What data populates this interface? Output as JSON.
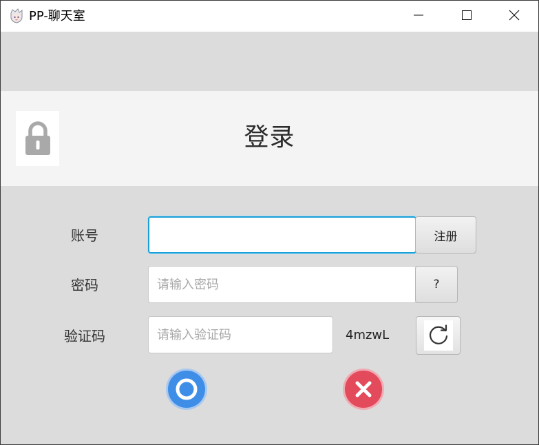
{
  "window": {
    "title": "PP-聊天室",
    "app_icon": "anime-avatar-icon",
    "controls": [
      "minimize-icon",
      "maximize-icon",
      "close-icon"
    ]
  },
  "header": {
    "title": "登录",
    "icon": "lock-icon"
  },
  "form": {
    "account": {
      "label": "账号",
      "value": "",
      "placeholder": "",
      "register_button": "注册"
    },
    "password": {
      "label": "密码",
      "value": "",
      "placeholder": "请输入密码",
      "help_button": "?"
    },
    "captcha": {
      "label": "验证码",
      "value": "",
      "placeholder": "请输入验证码",
      "code": "4mzwL",
      "refresh_icon": "refresh-icon"
    }
  },
  "actions": {
    "confirm_icon": "confirm-circle-icon",
    "cancel_icon": "cancel-x-icon"
  },
  "colors": {
    "accent_blue": "#3e8ee8",
    "cancel_red": "#e34a5c",
    "focus_border": "#1aa0d8"
  }
}
